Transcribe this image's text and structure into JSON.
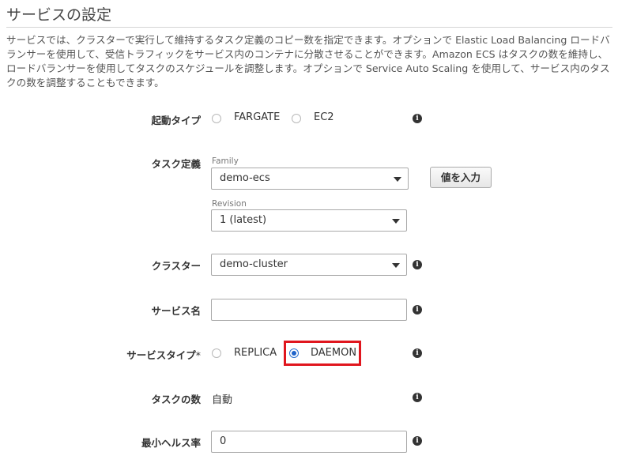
{
  "page": {
    "title": "サービスの設定",
    "description": "サービスでは、クラスターで実行して維持するタスク定義のコピー数を指定できます。オプションで Elastic Load Balancing ロードバランサーを使用して、受信トラフィックをサービス内のコンテナに分散させることができます。Amazon ECS はタスクの数を維持し、ロードバランサーを使用してタスクのスケジュールを調整します。オプションで Service Auto Scaling を使用して、サービス内のタスクの数を調整することもできます。"
  },
  "launch_type": {
    "label": "起動タイプ",
    "options": [
      "FARGATE",
      "EC2"
    ],
    "selected": ""
  },
  "task_definition": {
    "label": "タスク定義",
    "family_label": "Family",
    "family_value": "demo-ecs",
    "revision_label": "Revision",
    "revision_value": "1 (latest)",
    "enter_value_button": "値を入力"
  },
  "cluster": {
    "label": "クラスター",
    "value": "demo-cluster"
  },
  "service_name": {
    "label": "サービス名",
    "value": ""
  },
  "service_type": {
    "label": "サービスタイプ",
    "required_mark": "*",
    "options": [
      "REPLICA",
      "DAEMON"
    ],
    "selected": "DAEMON",
    "highlight_color": "#e0161e"
  },
  "task_count": {
    "label": "タスクの数",
    "value": "自動"
  },
  "min_health": {
    "label": "最小ヘルス率",
    "value": "0"
  },
  "icons": {
    "info": "info-icon",
    "dropdown": "chevron-down-icon"
  }
}
